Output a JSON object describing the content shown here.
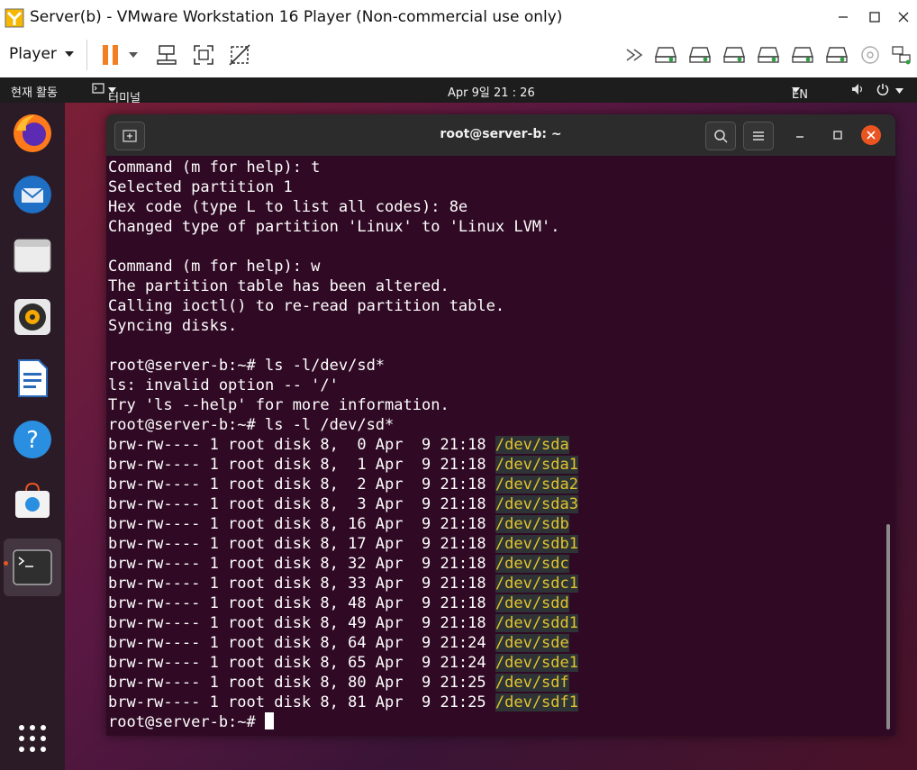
{
  "window": {
    "title": "Server(b) - VMware Workstation 16 Player (Non-commercial use only)"
  },
  "toolbar": {
    "player_label": "Player"
  },
  "topbar": {
    "activities": "현재 활동",
    "app_menu": "터미널",
    "clock": "Apr 9일 21 : 26",
    "language": "EN"
  },
  "terminal": {
    "title": "root@server-b: ~",
    "pre_lines": [
      "Command (m for help): t",
      "Selected partition 1",
      "Hex code (type L to list all codes): 8e",
      "Changed type of partition 'Linux' to 'Linux LVM'.",
      "",
      "Command (m for help): w",
      "The partition table has been altered.",
      "Calling ioctl() to re-read partition table.",
      "Syncing disks.",
      "",
      "root@server-b:~# ls -l/dev/sd*",
      "ls: invalid option -- '/'",
      "Try 'ls --help' for more information.",
      "root@server-b:~# ls -l /dev/sd*"
    ],
    "listing": [
      {
        "perm": "brw-rw---- 1 root disk 8,  0 Apr  9 21:18 ",
        "dev": "/dev/sda"
      },
      {
        "perm": "brw-rw---- 1 root disk 8,  1 Apr  9 21:18 ",
        "dev": "/dev/sda1"
      },
      {
        "perm": "brw-rw---- 1 root disk 8,  2 Apr  9 21:18 ",
        "dev": "/dev/sda2"
      },
      {
        "perm": "brw-rw---- 1 root disk 8,  3 Apr  9 21:18 ",
        "dev": "/dev/sda3"
      },
      {
        "perm": "brw-rw---- 1 root disk 8, 16 Apr  9 21:18 ",
        "dev": "/dev/sdb"
      },
      {
        "perm": "brw-rw---- 1 root disk 8, 17 Apr  9 21:18 ",
        "dev": "/dev/sdb1"
      },
      {
        "perm": "brw-rw---- 1 root disk 8, 32 Apr  9 21:18 ",
        "dev": "/dev/sdc"
      },
      {
        "perm": "brw-rw---- 1 root disk 8, 33 Apr  9 21:18 ",
        "dev": "/dev/sdc1"
      },
      {
        "perm": "brw-rw---- 1 root disk 8, 48 Apr  9 21:18 ",
        "dev": "/dev/sdd"
      },
      {
        "perm": "brw-rw---- 1 root disk 8, 49 Apr  9 21:18 ",
        "dev": "/dev/sdd1"
      },
      {
        "perm": "brw-rw---- 1 root disk 8, 64 Apr  9 21:24 ",
        "dev": "/dev/sde"
      },
      {
        "perm": "brw-rw---- 1 root disk 8, 65 Apr  9 21:24 ",
        "dev": "/dev/sde1"
      },
      {
        "perm": "brw-rw---- 1 root disk 8, 80 Apr  9 21:25 ",
        "dev": "/dev/sdf"
      },
      {
        "perm": "brw-rw---- 1 root disk 8, 81 Apr  9 21:25 ",
        "dev": "/dev/sdf1"
      }
    ],
    "prompt": "root@server-b:~# "
  },
  "dock": {
    "items": [
      "firefox-icon",
      "thunderbird-icon",
      "files-icon",
      "rhythmbox-icon",
      "writer-icon",
      "help-icon",
      "software-icon",
      "terminal-icon"
    ]
  },
  "colors": {
    "terminal_bg": "#300a24",
    "device_highlight": "#e3c42e",
    "close_button": "#e95420",
    "pause_button": "#f47f20"
  }
}
